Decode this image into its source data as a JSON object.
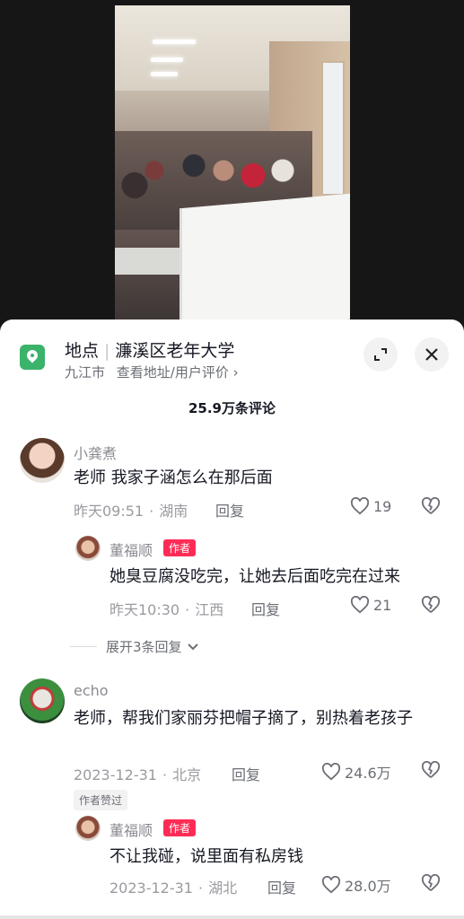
{
  "location": {
    "label": "地点",
    "name": "濂溪区老年大学",
    "city": "九江市",
    "link": "查看地址/用户评价",
    "link_arrow": "›"
  },
  "comments_count": "25.9万条评论",
  "expand_replies": "展开3条回复",
  "author_liked": "作者赞过",
  "author_tag": "作者",
  "comments": [
    {
      "user": "小龚煮",
      "text": "老师 我家子涵怎么在那后面",
      "time": "昨天09:51",
      "region": "湖南",
      "reply": "回复",
      "likes": "19",
      "replies": [
        {
          "user": "董福顺",
          "text": "她臭豆腐没吃完，让她去后面吃完在过来",
          "time": "昨天10:30",
          "region": "江西",
          "reply": "回复",
          "likes": "21"
        }
      ]
    },
    {
      "user": "echo",
      "text": "老师，帮我们家丽芬把帽子摘了，别热着老孩子",
      "time": "2023-12-31",
      "region": "北京",
      "reply": "回复",
      "likes": "24.6万",
      "replies": [
        {
          "user": "董福顺",
          "text": "不让我碰，说里面有私房钱",
          "time": "2023-12-31",
          "region": "湖北",
          "reply": "回复",
          "likes": "28.0万"
        }
      ]
    }
  ],
  "colors": {
    "accent_red": "#fe2c55",
    "location_green": "#3bb36b"
  }
}
